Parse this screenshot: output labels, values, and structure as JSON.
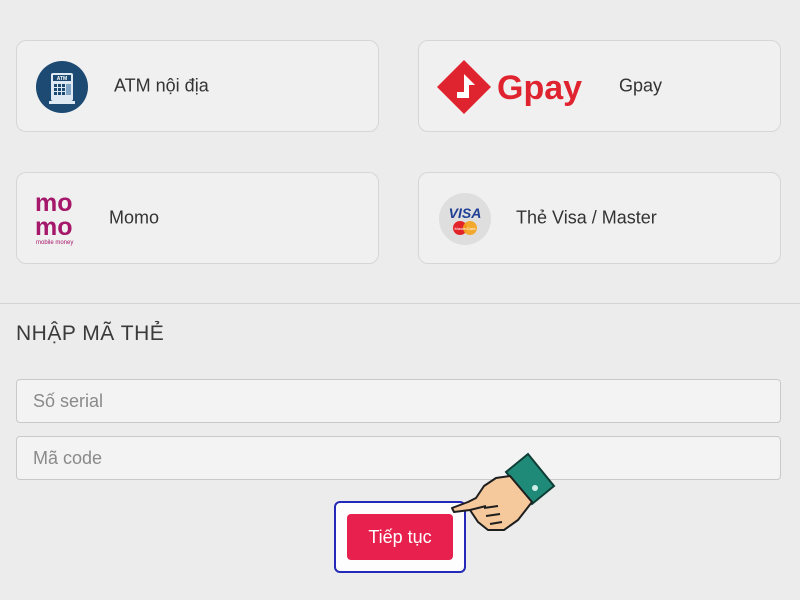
{
  "colors": {
    "background": "#ececec",
    "accent_red": "#e8204e",
    "selected_border": "#d9283f",
    "button_highlight_border": "#2329b8",
    "momo_purple": "#a5176a",
    "atm_navy": "#1d4a73"
  },
  "payment_methods": [
    {
      "label": "ATM nội địa",
      "icon": "atm-icon",
      "logo_text": "ATM"
    },
    {
      "label": "Gpay",
      "icon": "gpay-logo",
      "logo_text": "Gpay"
    },
    {
      "label": "Momo",
      "icon": "momo-logo",
      "logo_text_top": "mo",
      "logo_text_bottom": "mo",
      "logo_caption": "mobile money"
    },
    {
      "label": "Thẻ Visa / Master",
      "icon": "visa-master-icon",
      "logo_text": "VISA",
      "logo_caption": "MasterCard"
    }
  ],
  "card_section": {
    "title": "NHẬP MÃ THẺ",
    "serial_placeholder": "Số serial",
    "serial_value": "",
    "code_placeholder": "Mã code",
    "code_value": ""
  },
  "continue_button": {
    "label": "Tiếp tục"
  },
  "pointer": {
    "icon": "pointing-hand-icon"
  }
}
